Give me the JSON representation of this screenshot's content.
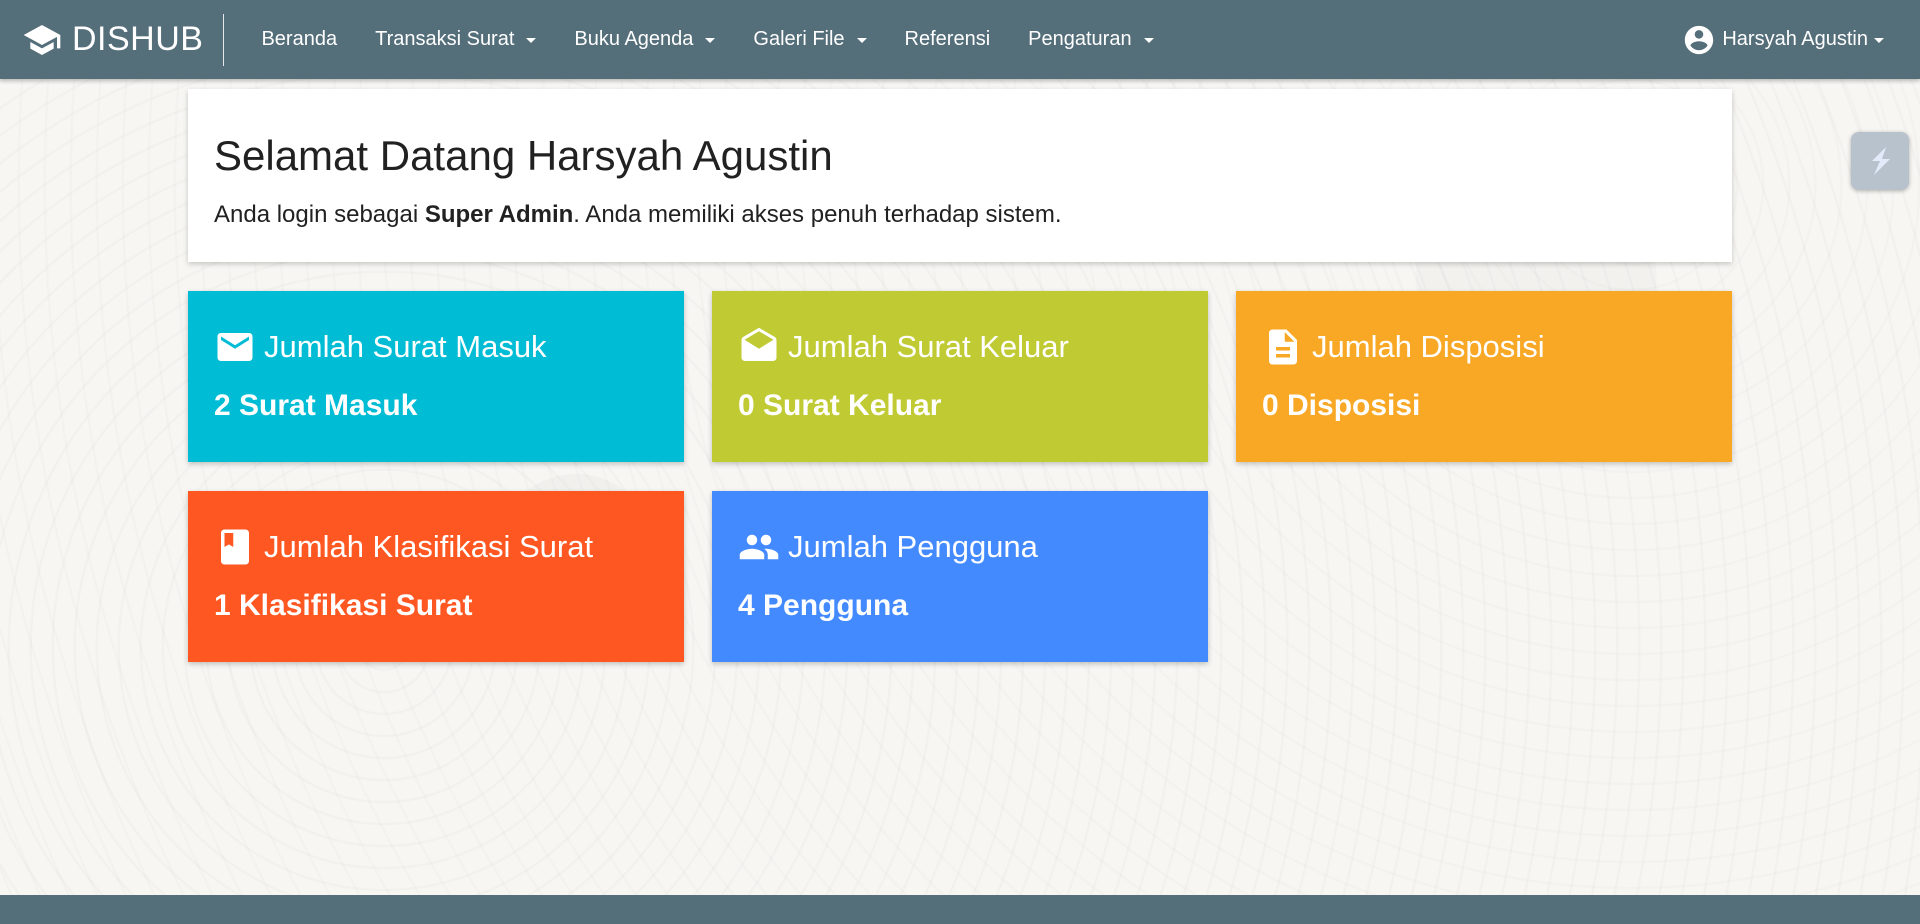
{
  "brand": {
    "name": "DISHUB",
    "icon": "graduation-cap-icon"
  },
  "nav": {
    "items": [
      {
        "label": "Beranda",
        "dropdown": false
      },
      {
        "label": "Transaksi Surat",
        "dropdown": true
      },
      {
        "label": "Buku Agenda",
        "dropdown": true
      },
      {
        "label": "Galeri File",
        "dropdown": true
      },
      {
        "label": "Referensi",
        "dropdown": false
      },
      {
        "label": "Pengaturan",
        "dropdown": true
      }
    ],
    "user": {
      "name": "Harsyah Agustin",
      "icon": "account-circle-icon"
    }
  },
  "welcome": {
    "title": "Selamat Datang Harsyah Agustin",
    "line_prefix": "Anda login sebagai ",
    "role": "Super Admin",
    "line_suffix": ". Anda memiliki akses penuh terhadap sistem."
  },
  "cards": [
    {
      "title": "Jumlah Surat Masuk",
      "count": "2 Surat Masuk",
      "color": "#00bcd4",
      "icon": "email-icon"
    },
    {
      "title": "Jumlah Surat Keluar",
      "count": "0 Surat Keluar",
      "color": "#c0ca33",
      "icon": "drafts-icon"
    },
    {
      "title": "Jumlah Disposisi",
      "count": "0 Disposisi",
      "color": "#f9a825",
      "icon": "description-icon"
    },
    {
      "title": "Jumlah Klasifikasi Surat",
      "count": "1 Klasifikasi Surat",
      "color": "#ff5722",
      "icon": "book-icon"
    },
    {
      "title": "Jumlah Pengguna",
      "count": "4 Pengguna",
      "color": "#448aff",
      "icon": "people-icon"
    }
  ],
  "colors": {
    "navbar": "#546e7a",
    "background": "#f7f6f3"
  }
}
